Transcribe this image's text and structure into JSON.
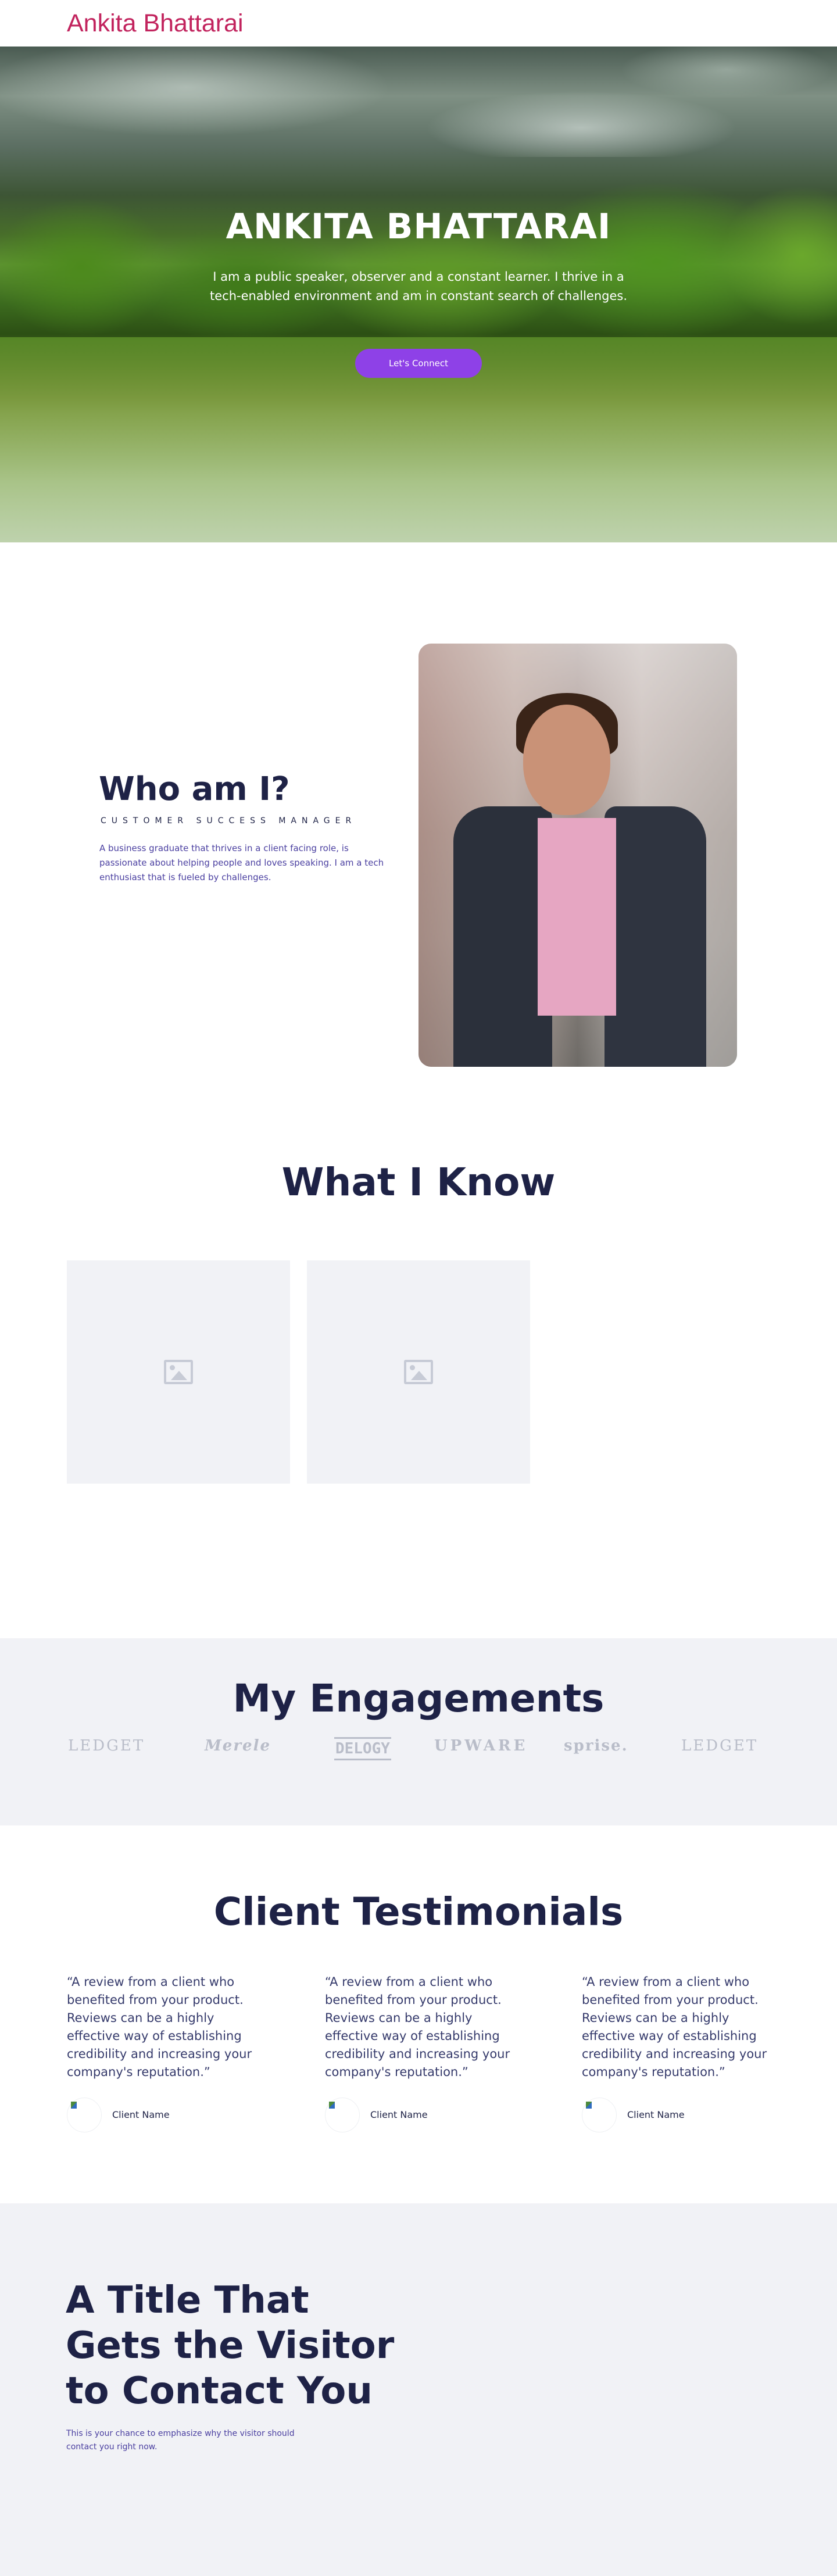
{
  "header": {
    "logo_text": "Ankita Bhattarai"
  },
  "hero": {
    "title": "ANKITA BHATTARAI",
    "subtitle": "I am a public speaker, observer and a constant learner. I thrive in a tech-enabled environment and am in constant search of challenges.",
    "cta_label": "Let's Connect"
  },
  "about": {
    "title": "Who am I?",
    "role": "CUSTOMER SUCCESS MANAGER",
    "description": "A business graduate that thrives in a client facing role, is passionate about helping people and loves speaking. I am a tech enthusiast that is fueled by challenges."
  },
  "skills": {
    "title": "What I Know"
  },
  "engagements": {
    "title": "My Engagements",
    "brands": [
      "LEDGET",
      "Merele",
      "DELOGY",
      "UPWARE",
      "sprise.",
      "LEDGET"
    ]
  },
  "testimonials": {
    "title": "Client Testimonials",
    "items": [
      {
        "quote": "“A review from a client who benefited from your product. Reviews can be a highly effective way of establishing credibility and increasing your company's reputation.”",
        "name": "Client Name"
      },
      {
        "quote": "“A review from a client who benefited from your product. Reviews can be a highly effective way of establishing credibility and increasing your company's reputation.”",
        "name": "Client Name"
      },
      {
        "quote": "“A review from a client who benefited from your product. Reviews can be a highly effective way of establishing credibility and increasing your company's reputation.”",
        "name": "Client Name"
      }
    ]
  },
  "contact": {
    "title": "A Title That Gets the Visitor to Contact You",
    "text": "This is your chance to emphasize why the visitor should contact you right now."
  }
}
